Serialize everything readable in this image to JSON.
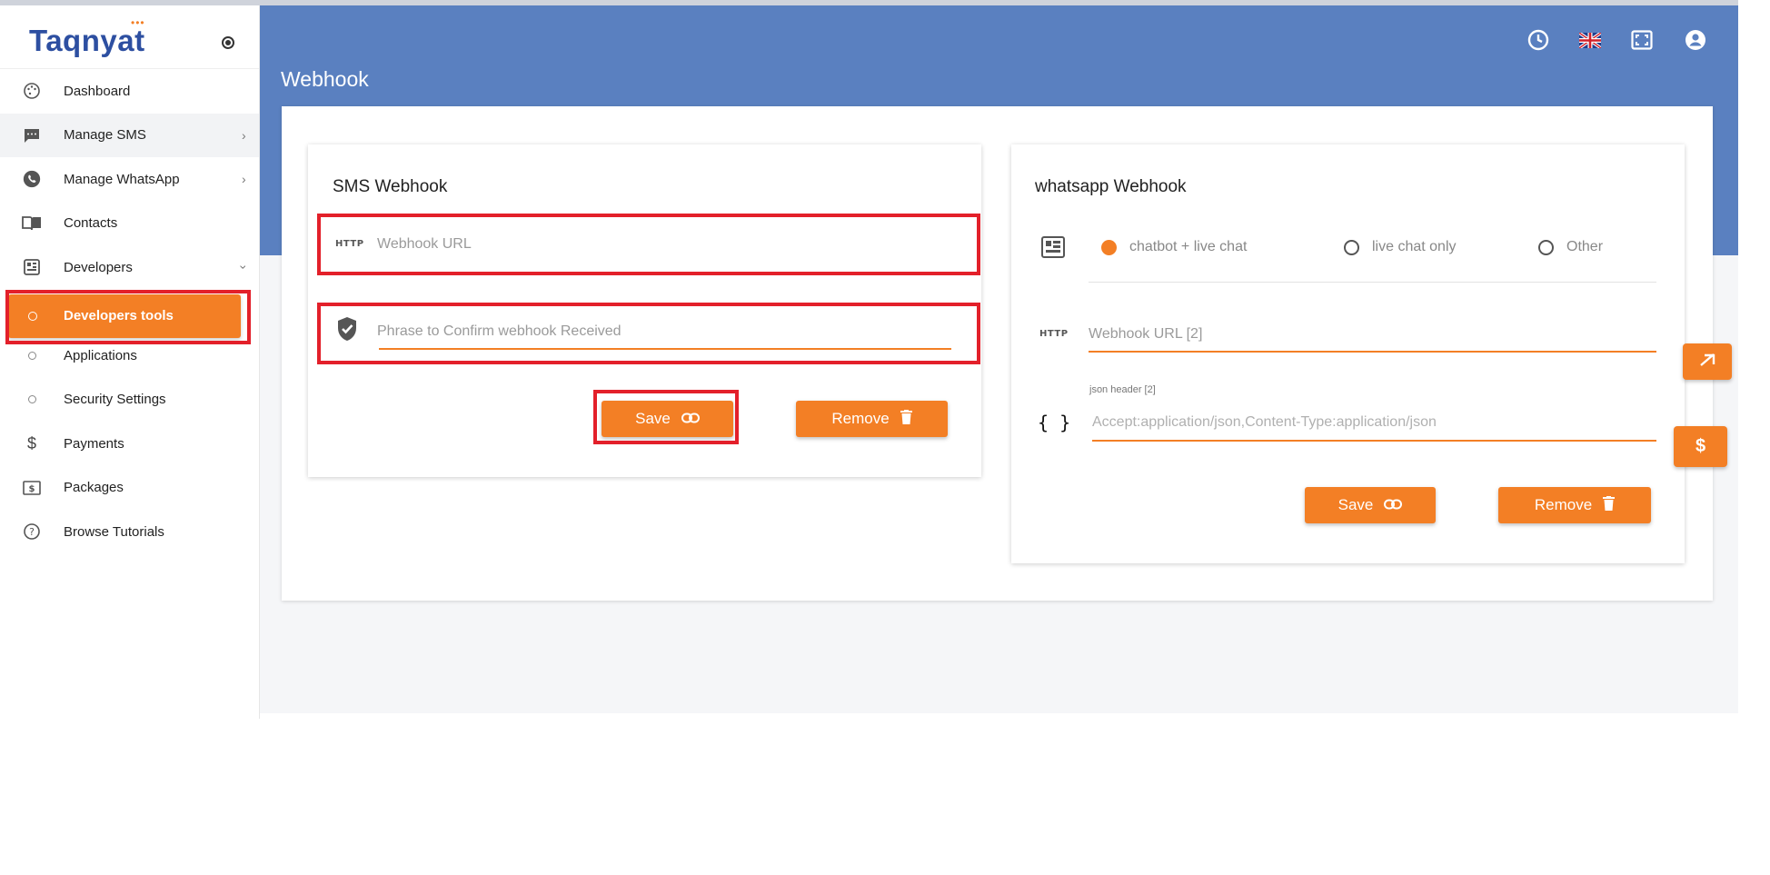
{
  "logo": {
    "text": "Taqnyat",
    "dots": "•••"
  },
  "sidebar": {
    "items": [
      {
        "label": "Dashboard"
      },
      {
        "label": "Manage SMS"
      },
      {
        "label": "Manage WhatsApp"
      },
      {
        "label": "Contacts"
      },
      {
        "label": "Developers"
      },
      {
        "label": "Developers tools"
      },
      {
        "label": "Applications"
      },
      {
        "label": "Security Settings"
      },
      {
        "label": "Payments"
      },
      {
        "label": "Packages"
      },
      {
        "label": "Browse Tutorials"
      }
    ]
  },
  "header": {
    "title": "Webhook"
  },
  "sms": {
    "title": "SMS Webhook",
    "http_tag": "HTTP",
    "url_placeholder": "Webhook URL",
    "phrase_placeholder": "Phrase to Confirm webhook Received",
    "save_label": "Save",
    "remove_label": "Remove"
  },
  "whatsapp": {
    "title": "whatsapp Webhook",
    "options": [
      "chatbot + live chat",
      "live chat only",
      "Other"
    ],
    "selected": "chatbot + live chat",
    "http_tag": "HTTP",
    "url_placeholder": "Webhook URL [2]",
    "json_label": "json header [2]",
    "json_icon": "{ }",
    "json_placeholder": "Accept:application/json,Content-Type:application/json",
    "save_label": "Save",
    "remove_label": "Remove"
  },
  "side_fabs": {
    "payment_symbol": "$"
  },
  "colors": {
    "accent": "#f37f25",
    "header": "#5a80c0",
    "highlight": "#e3202a"
  }
}
